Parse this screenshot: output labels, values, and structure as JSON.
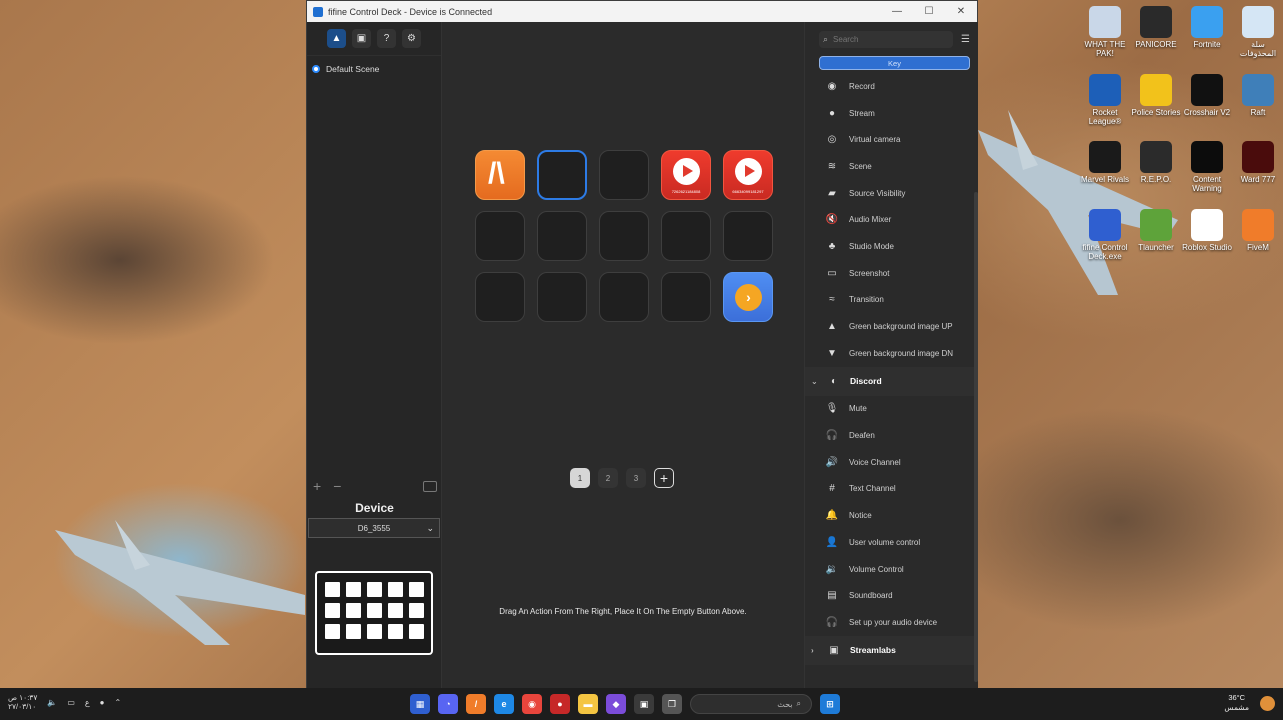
{
  "window": {
    "title": "fifine Control Deck - Device is Connected",
    "controls": [
      "—",
      "☐",
      "✕"
    ]
  },
  "left_panel": {
    "toolbar_icons": [
      "home-icon",
      "cube-icon",
      "help-icon",
      "settings-icon"
    ],
    "scene": "Default Scene",
    "device_label": "Device",
    "device_selected": "D6_3555"
  },
  "center": {
    "keys": [
      {
        "style": "orange",
        "icon": "fivem-logo",
        "label": ""
      },
      {
        "style": "selected",
        "icon": "",
        "label": ""
      },
      {
        "style": "empty",
        "icon": "",
        "label": ""
      },
      {
        "style": "red",
        "icon": "youtube-play-icon",
        "label": "7262621184808"
      },
      {
        "style": "red",
        "icon": "youtube-play-icon",
        "label": "66634099181297"
      },
      {
        "style": "empty"
      },
      {
        "style": "empty"
      },
      {
        "style": "empty"
      },
      {
        "style": "empty"
      },
      {
        "style": "empty"
      },
      {
        "style": "empty"
      },
      {
        "style": "empty"
      },
      {
        "style": "empty"
      },
      {
        "style": "empty"
      },
      {
        "style": "blue",
        "icon": "next-page-icon",
        "label": ""
      }
    ],
    "pages": [
      "1",
      "2",
      "3"
    ],
    "active_page": "1",
    "hint": "Drag An Action From The Right, Place It On The Empty Button Above."
  },
  "right_panel": {
    "search_placeholder": "Search",
    "tab": "Key",
    "obs_actions": [
      {
        "label": "Record",
        "icon": "record-icon"
      },
      {
        "label": "Stream",
        "icon": "stream-icon"
      },
      {
        "label": "Virtual camera",
        "icon": "camera-icon"
      },
      {
        "label": "Scene",
        "icon": "layers-icon"
      },
      {
        "label": "Source Visibility",
        "icon": "clapper-icon"
      },
      {
        "label": "Audio Mixer",
        "icon": "speaker-mute-icon"
      },
      {
        "label": "Studio Mode",
        "icon": "studio-icon"
      },
      {
        "label": "Screenshot",
        "icon": "screenshot-icon"
      },
      {
        "label": "Transition",
        "icon": "transition-icon"
      },
      {
        "label": "Green background image UP",
        "icon": "image-up-icon"
      },
      {
        "label": "Green background image DN",
        "icon": "image-down-icon"
      }
    ],
    "discord_group": "Discord",
    "discord_actions": [
      {
        "label": "Mute",
        "icon": "mic-mute-icon"
      },
      {
        "label": "Deafen",
        "icon": "headphone-icon"
      },
      {
        "label": "Voice Channel",
        "icon": "speaker-icon"
      },
      {
        "label": "Text Channel",
        "icon": "hash-icon"
      },
      {
        "label": "Notice",
        "icon": "bell-icon"
      },
      {
        "label": "User volume control",
        "icon": "user-volume-icon"
      },
      {
        "label": "Volume Control",
        "icon": "volume-icon"
      },
      {
        "label": "Soundboard",
        "icon": "soundboard-icon"
      },
      {
        "label": "Set up your audio device",
        "icon": "audio-device-icon"
      }
    ],
    "streamlabs_group": "Streamlabs"
  },
  "desktop_icons": [
    {
      "label": "WHAT THE PAK!",
      "color": "#c9d7e8"
    },
    {
      "label": "PANICORE",
      "color": "#2a2a2a"
    },
    {
      "label": "Fortnite",
      "color": "#3aa0f0"
    },
    {
      "label": "سلة المحذوفات",
      "color": "#d5e6f5"
    },
    {
      "label": "Rocket League®",
      "color": "#1d5fb8"
    },
    {
      "label": "Police Stories",
      "color": "#f2c21b"
    },
    {
      "label": "Crosshair V2",
      "color": "#111111"
    },
    {
      "label": "Raft",
      "color": "#3f7fb9"
    },
    {
      "label": "Marvel Rivals",
      "color": "#1a1a1a"
    },
    {
      "label": "R.E.P.O.",
      "color": "#2b2b2b"
    },
    {
      "label": "Content Warning",
      "color": "#0c0c0c"
    },
    {
      "label": "Ward 777",
      "color": "#4a0c0c"
    },
    {
      "label": "fifine Control Deck.exe",
      "color": "#2f5fd0"
    },
    {
      "label": "Tlauncher",
      "color": "#5ea33a"
    },
    {
      "label": "Roblox Studio",
      "color": "#ffffff"
    },
    {
      "label": "FiveM",
      "color": "#f07c2a"
    }
  ],
  "taskbar": {
    "time": "١٠:٣٧ ص",
    "date": "٢٧/٠٣/١٠",
    "lang": "ع",
    "search": "بحث",
    "weather_temp": "36°C",
    "weather_desc": "مشمس"
  }
}
